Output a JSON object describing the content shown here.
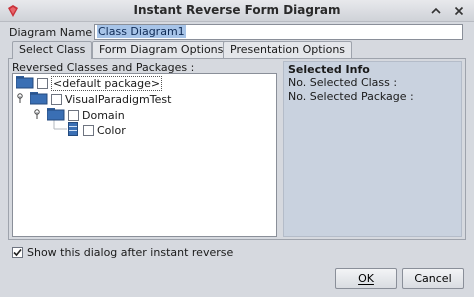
{
  "window": {
    "title": "Instant Reverse Form Diagram",
    "app_icon": "visual-paradigm-logo",
    "controls": [
      "maximize-icon",
      "close-icon"
    ]
  },
  "diagram_name": {
    "label": "Diagram Name :",
    "value": "Class Diagram1"
  },
  "tabs": [
    {
      "label": "Select Class",
      "active": true
    },
    {
      "label": "Form Diagram Options",
      "active": false
    },
    {
      "label": "Presentation Options",
      "active": false
    }
  ],
  "tree": {
    "label": "Reversed Classes and Packages :",
    "items": [
      {
        "label": "<default package>",
        "icon": "package-icon",
        "selected": true
      },
      {
        "label": "VisualParadigmTest",
        "icon": "package-icon"
      },
      {
        "label": "Domain",
        "icon": "package-icon"
      },
      {
        "label": "Color",
        "icon": "class-icon"
      }
    ]
  },
  "info": {
    "title": "Selected Info",
    "selected_class_label": "No. Selected Class :",
    "selected_package_label": "No. Selected Package :"
  },
  "show_dialog": {
    "label": "Show this dialog after instant reverse",
    "checked": true
  },
  "buttons": {
    "ok": "OK",
    "cancel": "Cancel"
  }
}
